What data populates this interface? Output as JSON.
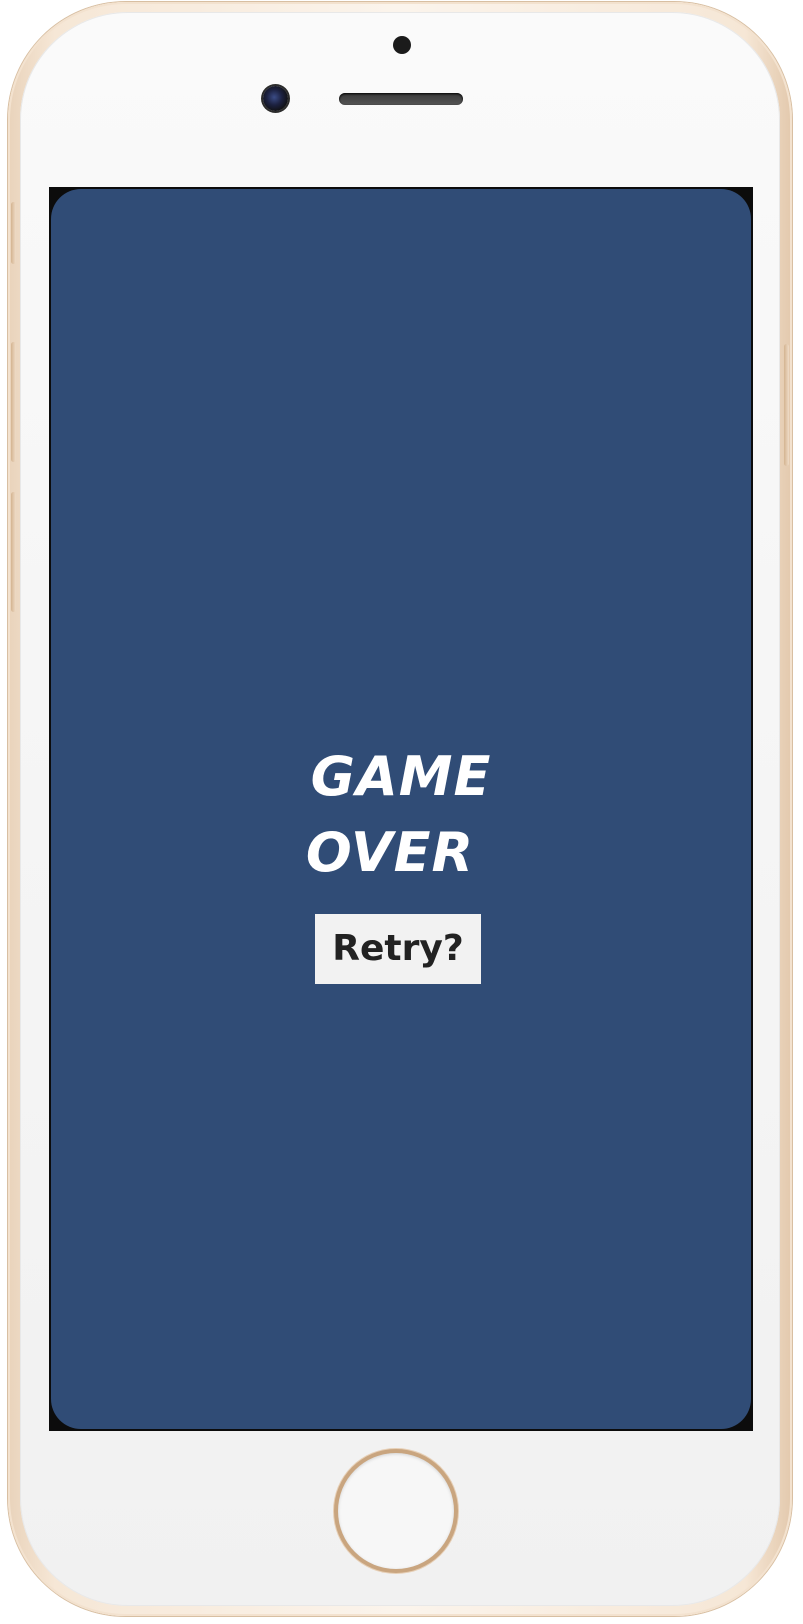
{
  "game": {
    "title_line_1": "GAME",
    "title_line_2": "OVER",
    "retry_label": "Retry?"
  },
  "colors": {
    "screen_background": "#304c76",
    "title_text": "#ffffff",
    "retry_button_background": "#f2f2f2",
    "retry_button_text": "#222222",
    "phone_frame": "#e9d3bb"
  },
  "icons": {
    "front_camera": "front-camera-icon",
    "facetime_camera": "facetime-camera-icon",
    "speaker": "speaker-grille-icon",
    "home": "home-button-icon"
  }
}
